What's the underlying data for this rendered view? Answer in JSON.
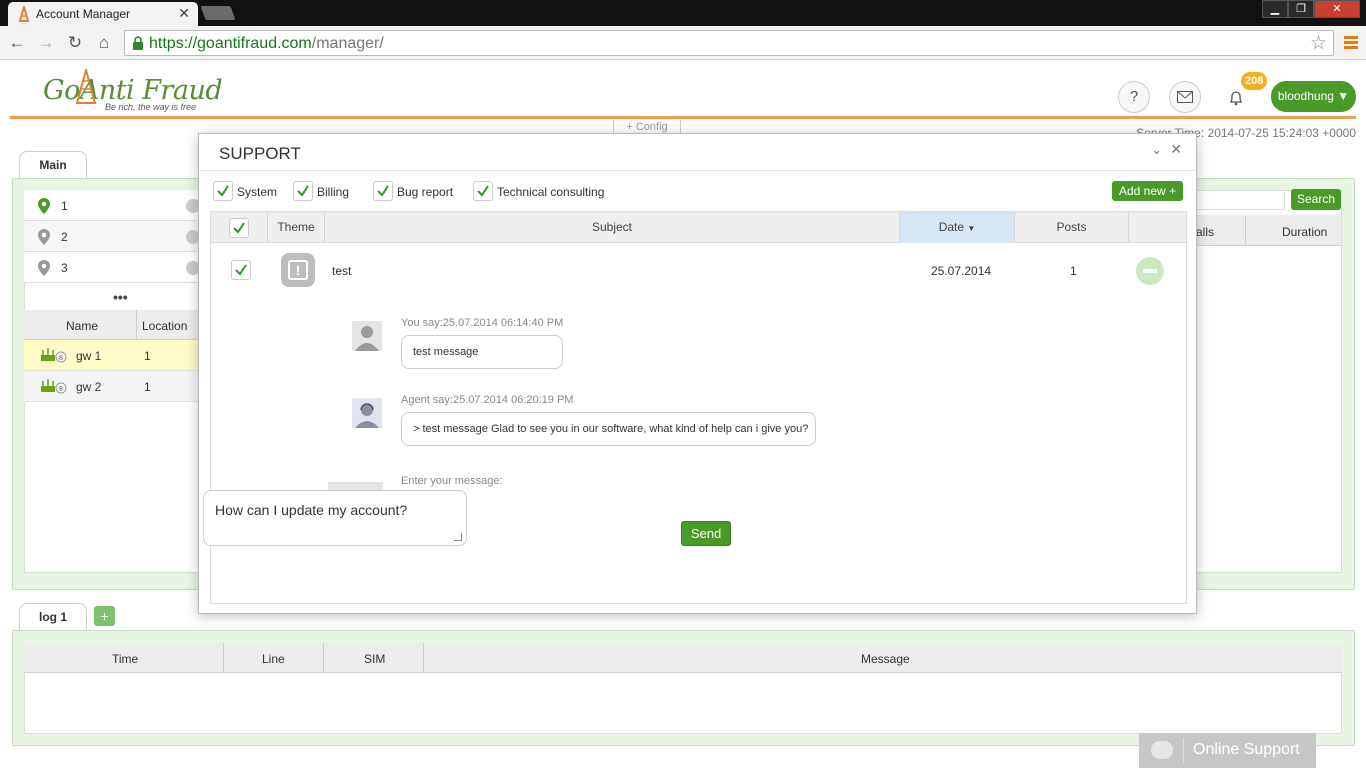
{
  "browser": {
    "tab_title": "Account Manager",
    "url_host": "https://goantifraud.com",
    "url_path": "/manager/"
  },
  "header": {
    "logo_text": "GoAnti Fraud",
    "logo_tagline": "Be rich, the way is free",
    "notification_count": "208",
    "username": "bloodhung ▼",
    "help_label": "?",
    "config_label": "+ Config",
    "server_time": "Server Time: 2014-07-25 15:24:03 +0000"
  },
  "main": {
    "tab_label": "Main",
    "locations": [
      "1",
      "2",
      "3"
    ],
    "more_label": "•••",
    "gateway_columns": [
      "Name",
      "Location"
    ],
    "gateways": [
      {
        "name": "gw 1",
        "location": "1"
      },
      {
        "name": "gw 2",
        "location": "1"
      }
    ],
    "search_label": "Search",
    "right_columns": [
      "alls",
      "Duration"
    ]
  },
  "log": {
    "tab_label": "log 1",
    "add_label": "+",
    "columns": [
      "Time",
      "Line",
      "SIM",
      "Message"
    ]
  },
  "online_support": "Online Support",
  "support": {
    "title": "SUPPORT",
    "filters": [
      "System",
      "Billing",
      "Bug report",
      "Technical consulting"
    ],
    "add_new_label": "Add new +",
    "columns": {
      "theme": "Theme",
      "subject": "Subject",
      "date": "Date",
      "posts": "Posts"
    },
    "ticket": {
      "subject": "test",
      "date": "25.07.2014",
      "posts": "1"
    },
    "messages": [
      {
        "meta": "You say:25.07.2014 06:14:40 PM",
        "text": "test message"
      },
      {
        "meta": "Agent say:25.07.2014 06:20:19 PM",
        "text": "> test message Glad to see you in our software, what kind of help can i give you?"
      }
    ],
    "enter_label": "Enter your message:",
    "input_value": "How can I update my account?",
    "send_label": "Send"
  },
  "colors": {
    "brand_green": "#4a9a2a",
    "accent_orange": "#e8a050",
    "badge": "#f0b020"
  }
}
